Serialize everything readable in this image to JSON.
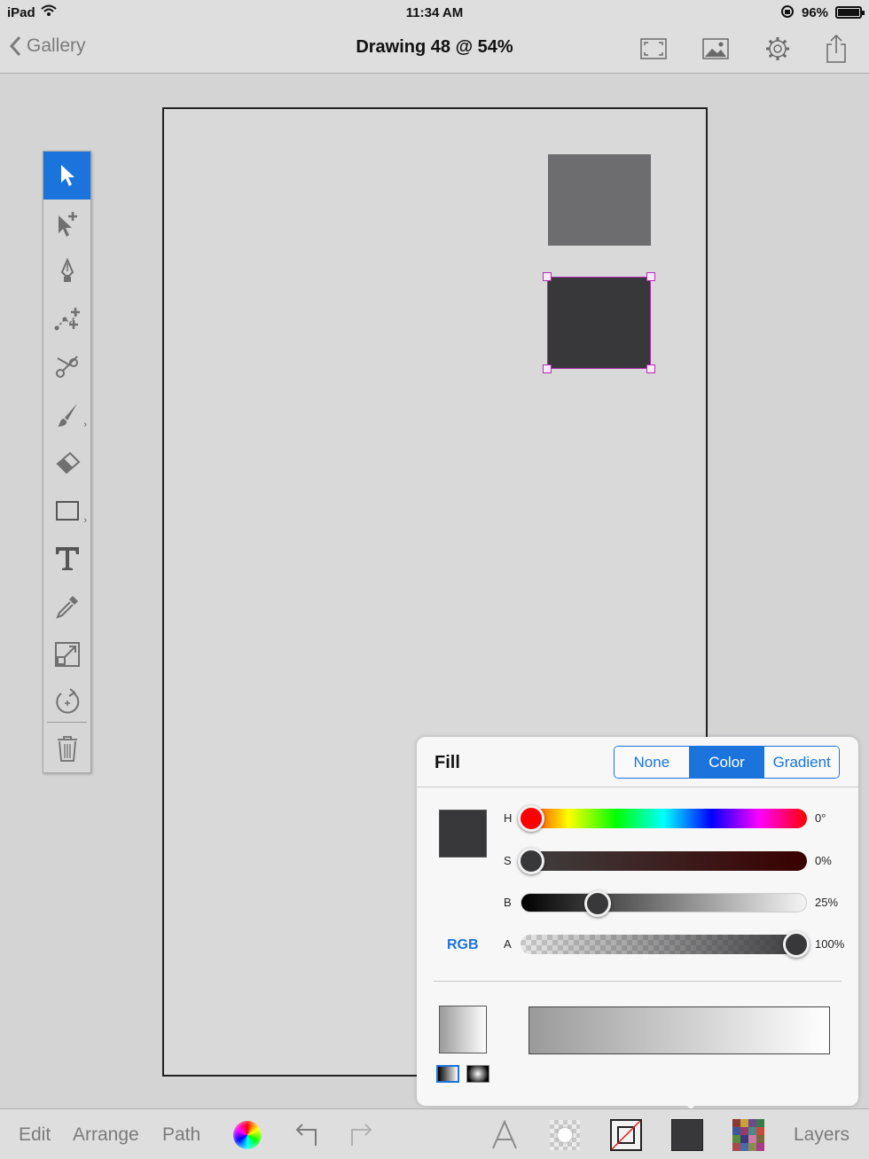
{
  "status_bar": {
    "carrier": "iPad",
    "time": "11:34 AM",
    "battery": "96%"
  },
  "nav": {
    "back_label": "Gallery",
    "title": "Drawing 48 @ 54%"
  },
  "fill_panel": {
    "title": "Fill",
    "segments": [
      "None",
      "Color",
      "Gradient"
    ],
    "selected_segment": "Color",
    "color_mode_button": "RGB",
    "current_color": "#38383a",
    "sliders": [
      {
        "label": "H",
        "value": "0°",
        "fraction": 0.0,
        "thumb_color": "#ff0000"
      },
      {
        "label": "S",
        "value": "0%",
        "fraction": 0.0,
        "thumb_color": "#38383a"
      },
      {
        "label": "B",
        "value": "25%",
        "fraction": 0.25,
        "thumb_color": "#38383a"
      },
      {
        "label": "A",
        "value": "100%",
        "fraction": 1.0,
        "thumb_color": "#38383a"
      }
    ]
  },
  "bottom_toolbar": {
    "edit": "Edit",
    "arrange": "Arrange",
    "path": "Path",
    "layers": "Layers"
  },
  "colors": {
    "accent": "#1a74dc",
    "selection": "#b52db5",
    "shape_light": "#6d6c6e",
    "shape_dark": "#38383a"
  }
}
